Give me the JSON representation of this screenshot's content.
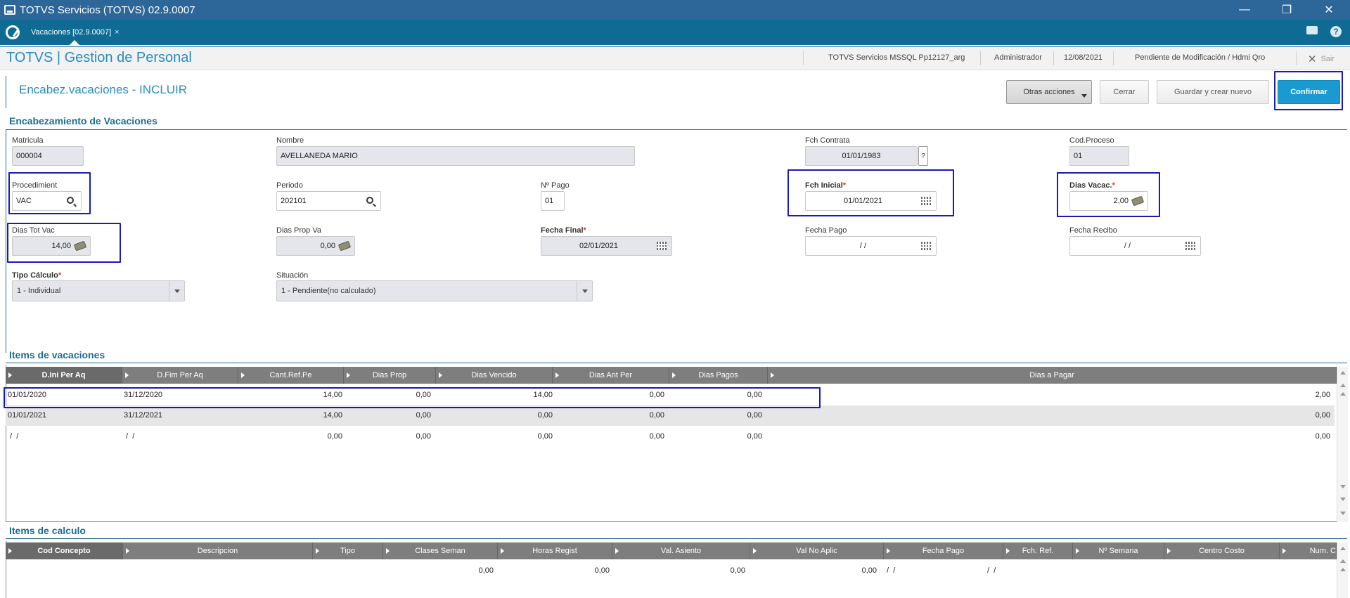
{
  "window": {
    "title": "TOTVS Servicios (TOTVS) 02.9.0007",
    "minimize": "—",
    "restore": "❐",
    "close": "✕"
  },
  "tabs": [
    {
      "label": "Vacaciones [02.9.0007]",
      "close": "×"
    }
  ],
  "header": {
    "brand": "TOTVS | Gestion de Personal",
    "environment": "TOTVS Servicios MSSQL Pp12127_arg",
    "user": "Administrador",
    "date": "12/08/2021",
    "status": "Pendiente de Modificación / Hdmi Qro",
    "exit_label": "Sair",
    "exit_icon": "✕"
  },
  "form": {
    "title": "Encabez.vacaciones - INCLUIR",
    "buttons": {
      "other": "Otras acciones",
      "close": "Cerrar",
      "save_new": "Guardar y crear nuevo",
      "confirm": "Confirmar"
    }
  },
  "section_header": {
    "title": "Encabezamiento de Vacaciones",
    "required_mark": "*",
    "matricula": {
      "label": "Matricula",
      "value": "000004"
    },
    "nombre": {
      "label": "Nombre",
      "value": "AVELLANEDA MARIO"
    },
    "fch_contrata": {
      "label": "Fch Contrata",
      "value": "01/01/1983",
      "help": "?"
    },
    "cod_proceso": {
      "label": "Cod.Proceso",
      "value": "01"
    },
    "procedimiento": {
      "label": "Procedimient",
      "value": "VAC"
    },
    "periodo": {
      "label": "Periodo",
      "value": "202101"
    },
    "nro_pago": {
      "label": "Nº Pago",
      "value": "01"
    },
    "fch_inicial": {
      "label": "Fch Inicial",
      "value": "01/01/2021"
    },
    "dias_vacac": {
      "label": "Dias Vacac.",
      "value": "2,00"
    },
    "dias_tot_vac": {
      "label": "Dias Tot Vac",
      "value": "14,00"
    },
    "dias_prop_va": {
      "label": "Dias Prop Va",
      "value": "0,00"
    },
    "fecha_final": {
      "label": "Fecha Final",
      "value": "02/01/2021"
    },
    "fecha_pago": {
      "label": "Fecha Pago",
      "value": "/ /"
    },
    "fecha_recibo": {
      "label": "Fecha Recibo",
      "value": "/ /"
    },
    "tipo_calculo": {
      "label": "Tipo Cálculo",
      "value": "1 -  Individual"
    },
    "situacion": {
      "label": "Situación",
      "value": "1 - Pendiente(no calculado)"
    }
  },
  "items_vacaciones": {
    "title": "Items de vacaciones",
    "columns": [
      "D.Ini Per Aq",
      "D.Fim Per Aq",
      "Cant.Ref.Pe",
      "Dias Prop",
      "Dias Vencido",
      "Dias Ant Per",
      "Dias Pagos",
      "Dias a Pagar"
    ],
    "rows": [
      [
        "01/01/2020",
        "31/12/2020",
        "14,00",
        "0,00",
        "14,00",
        "0,00",
        "0,00",
        "2,00"
      ],
      [
        "01/01/2021",
        "31/12/2021",
        "14,00",
        "0,00",
        "0,00",
        "0,00",
        "0,00",
        "0,00"
      ],
      [
        " /  /",
        " /  /",
        "0,00",
        "0,00",
        "0,00",
        "0,00",
        "0,00",
        "0,00"
      ]
    ]
  },
  "items_calculo": {
    "title": "Items de calculo",
    "columns": [
      "Cod Concepto",
      "Descripcion",
      "Tipo",
      "Clases Seman",
      "Horas Regist",
      "Val. Asiento",
      "Val No Aplic",
      "Fecha Pago",
      "Fch. Ref.",
      "Nº Semana",
      "Centro Costo",
      "Num. C"
    ],
    "rows": [
      [
        "",
        "",
        "",
        "0,00",
        "0,00",
        "0,00",
        "0,00",
        " /  /",
        " /  /",
        "",
        "",
        ""
      ]
    ]
  }
}
